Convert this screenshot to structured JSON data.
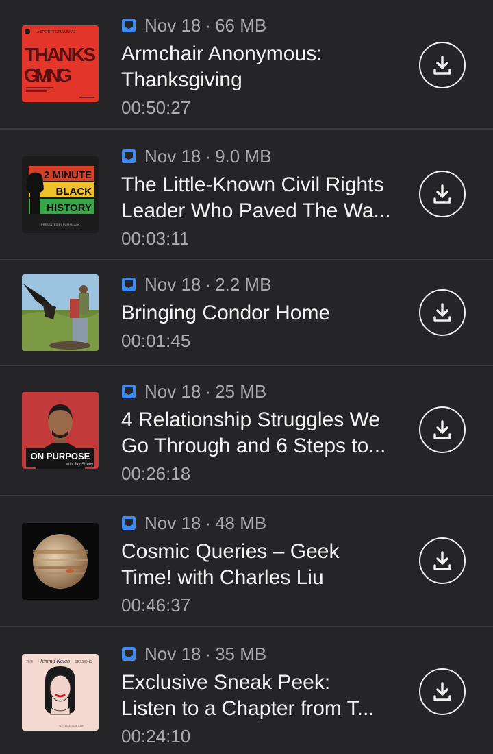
{
  "episodes": [
    {
      "date": "Nov 18",
      "size": "66 MB",
      "title_line1": "Armchair Anonymous:",
      "title_line2": "Thanksgiving",
      "duration": "00:50:27",
      "art": {
        "top_text": "A SPOTIFY EXCLUSIVE",
        "line1": "THANKS",
        "line2": "GIVING",
        "bg": "#e3352a"
      }
    },
    {
      "date": "Nov 18",
      "size": "9.0 MB",
      "title_line1": "The Little-Known Civil Rights",
      "title_line2": "Leader Who Paved The Wa...",
      "duration": "00:03:11",
      "art": {
        "line1": "2 MINUTE",
        "line2": "BLACK",
        "line3": "HISTORY",
        "footer": "PRESENTED BY PUSHBLACK"
      }
    },
    {
      "date": "Nov 18",
      "size": "2.2 MB",
      "title_line1": "Bringing Condor Home",
      "title_line2": "",
      "duration": "00:01:45",
      "art": {}
    },
    {
      "date": "Nov 18",
      "size": "25 MB",
      "title_line1": "4 Relationship Struggles We",
      "title_line2": "Go Through and 6 Steps to...",
      "duration": "00:26:18",
      "art": {
        "line1": "ON PURPOSE",
        "line2": "with Jay Shetty"
      }
    },
    {
      "date": "Nov 18",
      "size": "48 MB",
      "title_line1": "Cosmic Queries – Geek",
      "title_line2": "Time! with Charles Liu",
      "duration": "00:46:37",
      "art": {}
    },
    {
      "date": "Nov 18",
      "size": "35 MB",
      "title_line1": "Exclusive Sneak Peek:",
      "title_line2": "Listen to a Chapter from T...",
      "duration": "00:24:10",
      "art": {
        "line1": "THE",
        "line2": "Jemma Kalan",
        "line3": "SESSIONS",
        "footer": "WITH NATALIE LUE"
      }
    }
  ],
  "colors": {
    "background": "#252527",
    "meta_text": "#a9a9ae",
    "accent_blue": "#3d8bf2",
    "divider": "#3a3a3c"
  }
}
